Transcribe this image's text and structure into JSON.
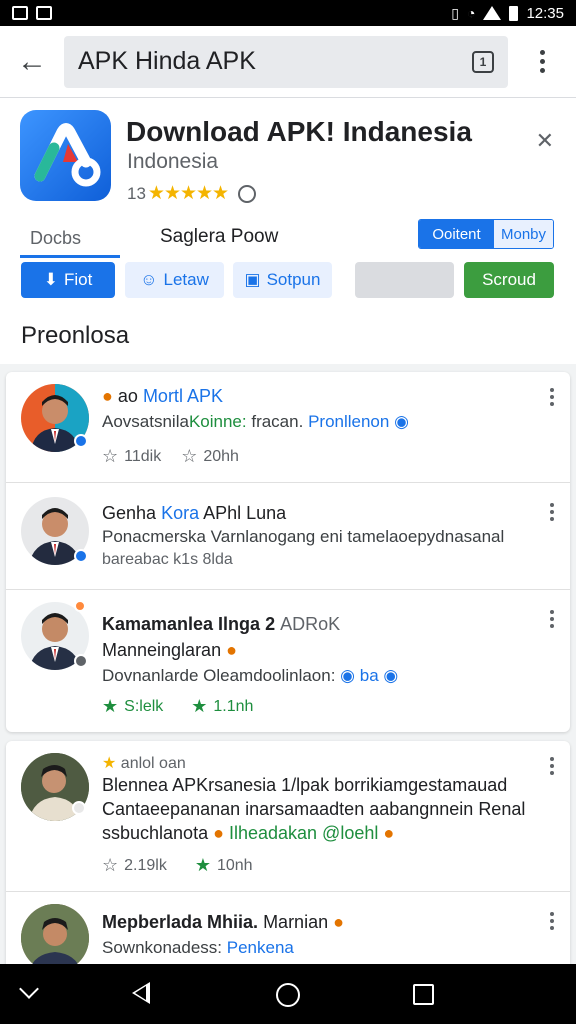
{
  "status_bar": {
    "time": "12:35"
  },
  "app_bar": {
    "search_text": "APK Hinda APK"
  },
  "header": {
    "title": "Download APK! Indanesia",
    "subtitle": "Indonesia",
    "rating_count": "13",
    "stars": "★★★★★",
    "tab_left": "Docbs",
    "tab_mid": "Saglera Poow",
    "toggle_a": "Ooitent",
    "toggle_b": "Monby",
    "actions": {
      "primary": "Fiot",
      "s1": "Letaw",
      "s2": "Sotpun",
      "green": "Scroud"
    },
    "section_title": "Preonlosa"
  },
  "posts": [
    {
      "name_a": "ao",
      "name_b": "Mortl APK",
      "body_a": "Aovsatsnila",
      "body_b": "Koinne:",
      "body_c": "fracan.",
      "body_d": "Pronllenon",
      "meta_1": "11dik",
      "meta_2": "20hh"
    },
    {
      "name_a": "Genha",
      "name_b": "Kora",
      "name_c": "APhl Luna",
      "body_a": "Ponacmerska Varnlanogang eni tamelaoepydnasanal",
      "meta_1": "bareabac k1s 8lda"
    },
    {
      "name_a": "Kamamanlea Ilnga 2",
      "name_b": "ADRoK",
      "body_a": "Manneinglaran",
      "body_b": "Dovnanlarde Oleamdoolinlaon:",
      "body_c": "ba",
      "meta_1": "S:lelk",
      "meta_2": "1.1nh"
    },
    {
      "tag": "anlol oan",
      "body_a": "Blennea APKrsanesia 1/lpak borrikiamgestamauad",
      "body_b": "Cantaeepananan inarsamaadten aabangnnein Renal",
      "body_c": "ssbuchlanota",
      "body_d": "Ilheadakan @loehl",
      "meta_1": "2.19lk",
      "meta_2": "10nh"
    },
    {
      "name_a": "Mepberlada Mhiia.",
      "name_b": "Marnian",
      "body_a": "Sownkonadess:",
      "body_b": "Penkena"
    }
  ]
}
